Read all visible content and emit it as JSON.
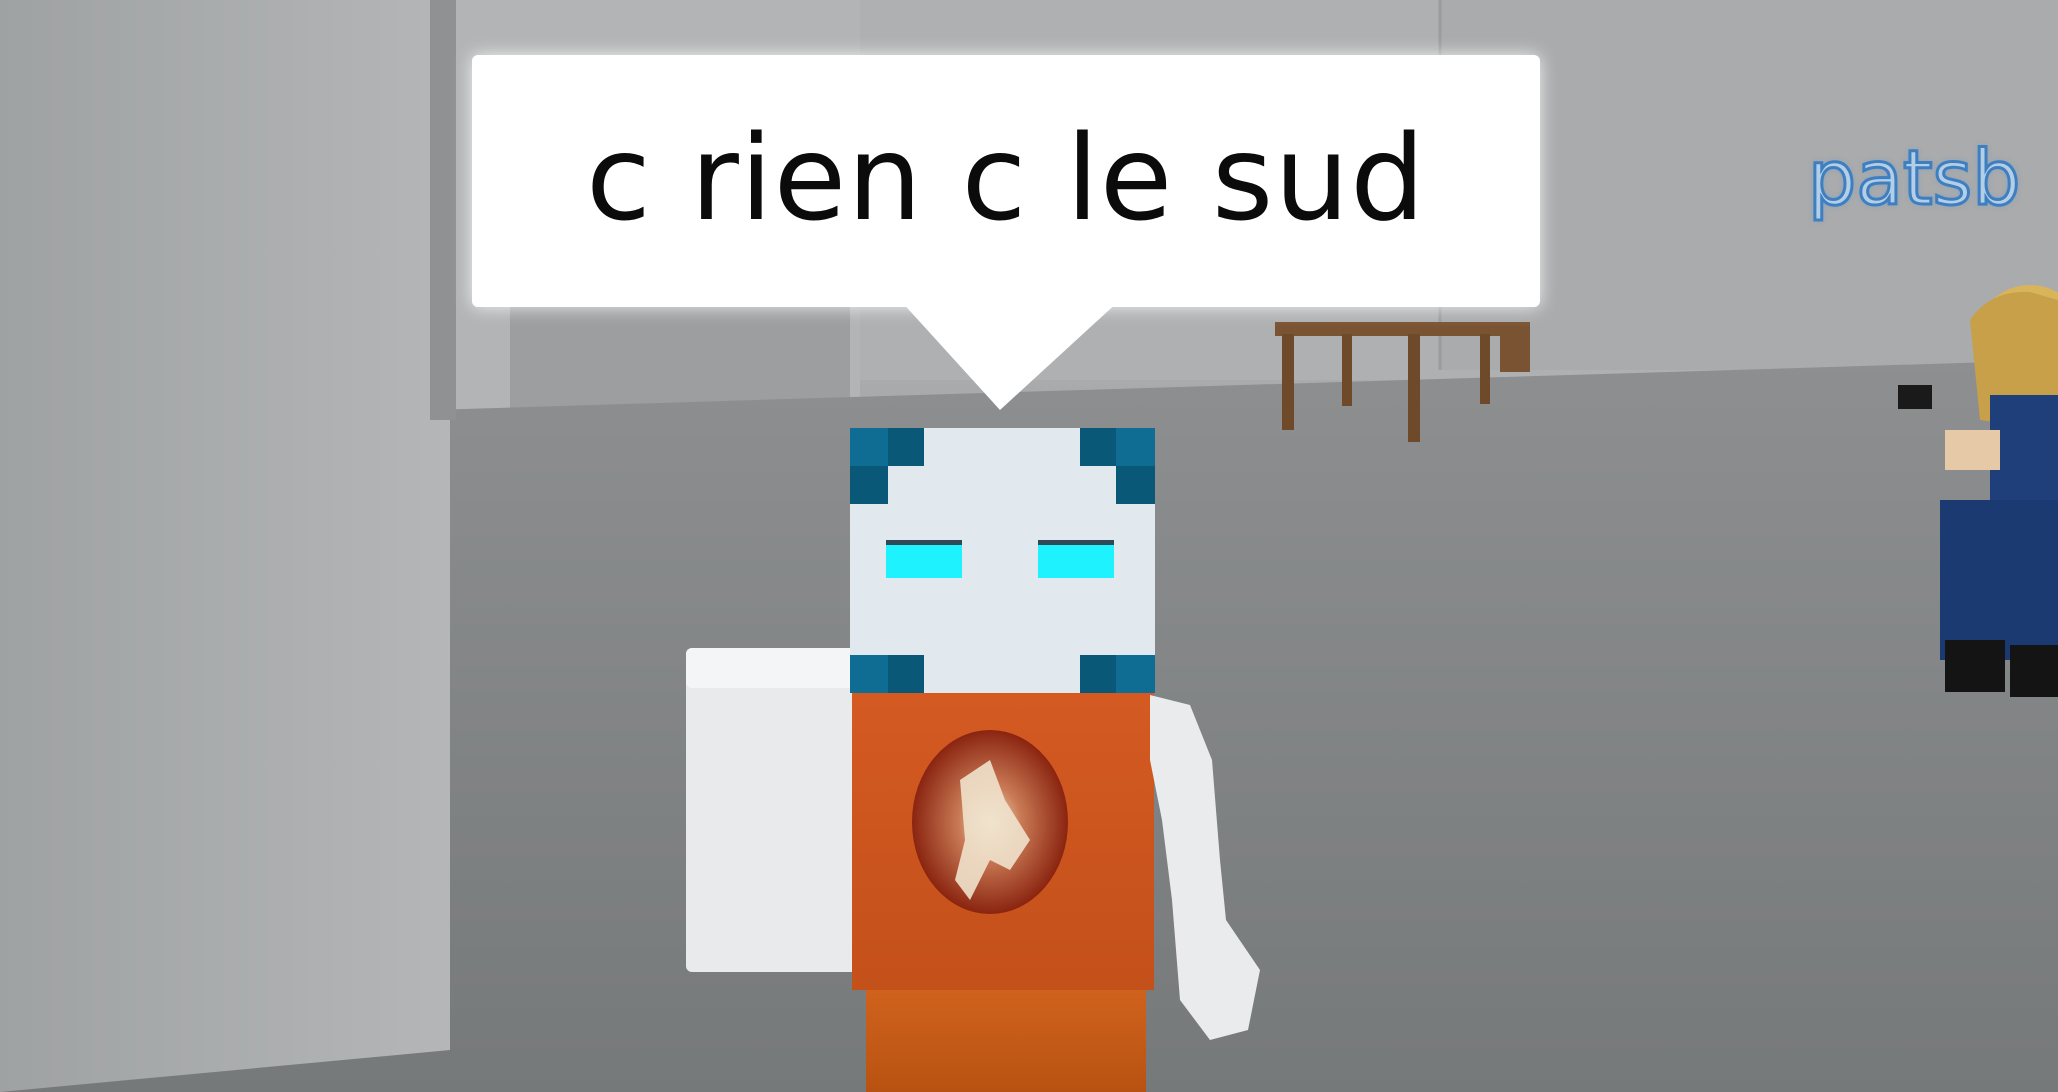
{
  "chat_bubble": {
    "text": "c rien c le sud"
  },
  "player_nametag": {
    "text": "patsb"
  },
  "colors": {
    "bubble_background": "#ffffff",
    "bubble_text": "#0b0b0b",
    "head_face": "#e1e8ee",
    "head_corner": "#0f6c93",
    "eyes": "#1ef2ff",
    "torso_shirt": "#d4521d",
    "arm": "#eef0f1",
    "floor": "#7f8182",
    "wall": "#a3a5a6",
    "nametag": "#b3cfe8"
  },
  "icons": [
    "roblox-avatar-main",
    "roblox-avatar-blonde-police",
    "wooden-table"
  ]
}
